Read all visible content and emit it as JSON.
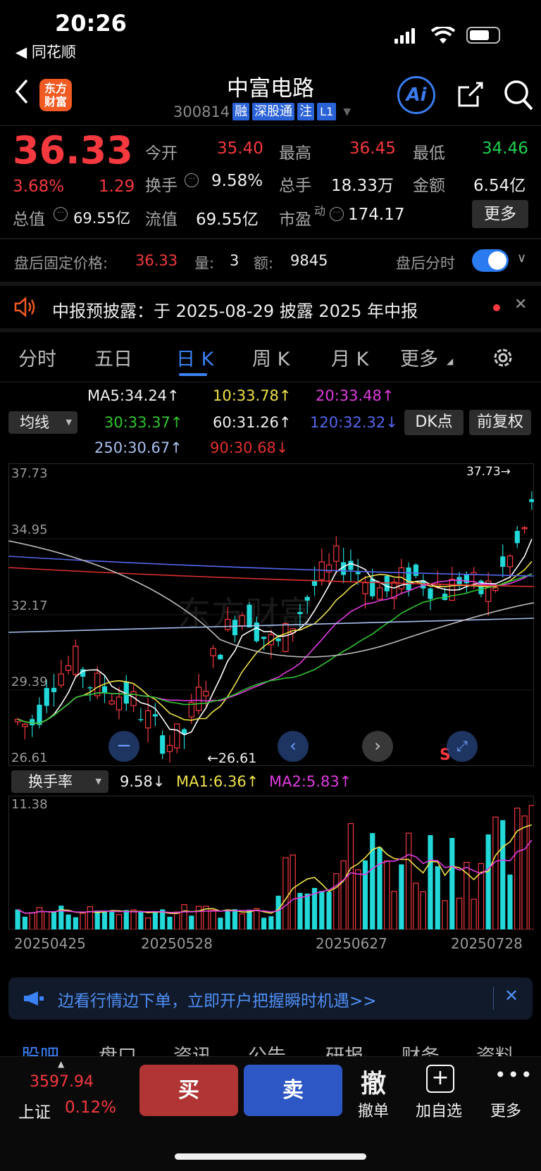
{
  "status": {
    "time": "20:26",
    "back_app": "◀ 同花顺"
  },
  "header": {
    "title": "中富电路",
    "code": "300814",
    "tags": [
      "融",
      "深股通",
      "注",
      "L1"
    ],
    "ai_label": "Ai"
  },
  "quote": {
    "price": "36.33",
    "pct": "3.68%",
    "chg": "1.29",
    "open_label": "今开",
    "open": "35.40",
    "high_label": "最高",
    "high": "36.45",
    "low_label": "最低",
    "low": "34.46",
    "turnover_label": "换手",
    "turnover": "9.58%",
    "volume_label": "总手",
    "volume": "18.33万",
    "amount_label": "金额",
    "amount": "6.54亿",
    "mktcap_label": "总值",
    "mktcap": "69.55亿",
    "float_label": "流值",
    "float_cap": "69.55亿",
    "pe_label": "市盈",
    "pe_sup": "动",
    "pe": "174.17",
    "more": "更多"
  },
  "after_hours": {
    "label": "盘后固定价格:",
    "price": "36.33",
    "vol_label": "量:",
    "vol": "3",
    "amt_label": "额:",
    "amt": "9845",
    "toggle_label": "盘后分时"
  },
  "notice": {
    "text": "中报预披露：于 2025-08-29 披露 2025 年中报"
  },
  "tabs": [
    "分时",
    "五日",
    "日 K",
    "周 K",
    "月 K",
    "更多"
  ],
  "active_tab": "日 K",
  "ma_info": {
    "select": "均线",
    "ma5": "MA5:34.24↑",
    "ma10": "10:33.78↑",
    "ma20": "20:33.48↑",
    "ma30": "30:33.37↑",
    "ma60": "60:31.26↑",
    "ma120": "120:32.32↓",
    "ma250": "250:30.67↑",
    "ma90": "90:30.68↓",
    "dk_btn": "DK点",
    "adj_btn": "前复权"
  },
  "kline": {
    "y_labels": [
      "37.73",
      "34.95",
      "32.17",
      "29.39",
      "26.61"
    ],
    "high_mark": "37.73→",
    "low_mark": "←26.61",
    "s_mark": "S"
  },
  "sub_indicator": {
    "select": "换手率",
    "val": "9.58↓",
    "ma1": "MA1:6.36↑",
    "ma2": "MA2:5.83↑",
    "top_label": "11.38",
    "dates": [
      "20250425",
      "20250528",
      "20250627",
      "20250728"
    ]
  },
  "banner": {
    "text": "边看行情边下单，立即开户把握瞬时机遇>>"
  },
  "bottom_tabs": [
    "股吧",
    "盘口",
    "资讯",
    "公告",
    "研报",
    "财务",
    "资料"
  ],
  "bottom_bar": {
    "index_value": "3597.94",
    "index_name": "上证",
    "index_pct": "0.12%",
    "buy": "买",
    "sell": "卖",
    "cancel_glyph": "撤",
    "cancel": "撤单",
    "add": "加自选",
    "more": "更多"
  },
  "colors": {
    "up": "#f5393f",
    "down": "#22d8d8",
    "accent": "#2a62d8",
    "bg": "#000000"
  }
}
